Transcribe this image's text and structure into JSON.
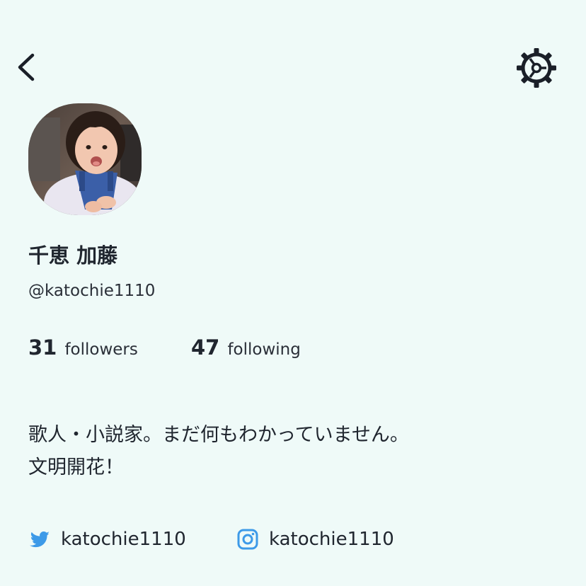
{
  "header": {
    "back_icon": "chevron-left-icon",
    "settings_icon": "gear-icon"
  },
  "profile": {
    "name": "千恵 加藤",
    "handle": "@katochie1110",
    "followers_count": "31",
    "followers_label": "followers",
    "following_count": "47",
    "following_label": "following",
    "bio_line1": "歌人・小説家。まだ何もわかっていません。",
    "bio_line2": "文明開花！"
  },
  "social": {
    "twitter": {
      "icon": "twitter-icon",
      "username": "katochie1110",
      "color": "#3d9ae8"
    },
    "instagram": {
      "icon": "instagram-icon",
      "username": "katochie1110",
      "color": "#3d9ae8"
    }
  },
  "colors": {
    "background": "#effaf8",
    "text": "#20262f",
    "accent": "#3d9ae8"
  }
}
